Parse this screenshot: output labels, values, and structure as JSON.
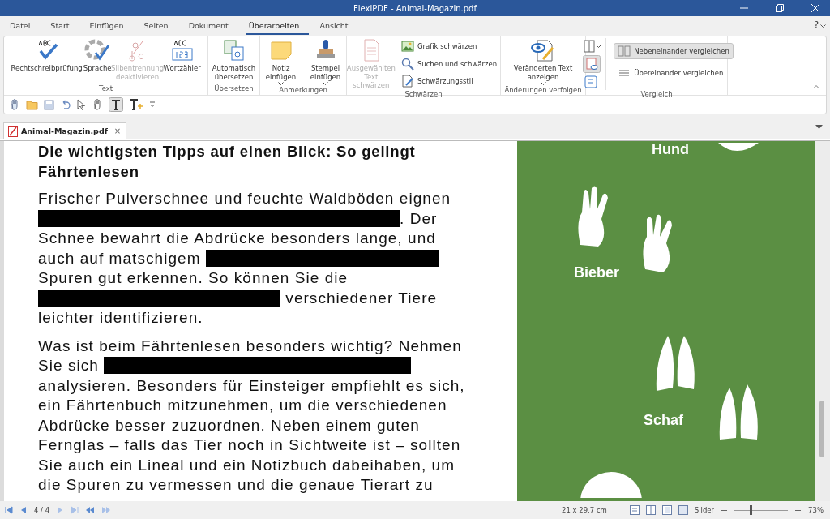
{
  "window": {
    "title": "FlexiPDF - Animal-Magazin.pdf"
  },
  "menu_tabs": [
    {
      "label": "Datei",
      "selected": false
    },
    {
      "label": "Start",
      "selected": false
    },
    {
      "label": "Einfügen",
      "selected": false
    },
    {
      "label": "Seiten",
      "selected": false
    },
    {
      "label": "Dokument",
      "selected": false
    },
    {
      "label": "Überarbeiten",
      "selected": true
    },
    {
      "label": "Ansicht",
      "selected": false
    }
  ],
  "help": "?",
  "ribbon_groups": [
    {
      "label": "Text",
      "buttons": [
        {
          "kind": "large",
          "label": "Rechtschreibprüfung",
          "disabled": false,
          "dropdown": false
        },
        {
          "kind": "large",
          "label": "Sprache",
          "disabled": false,
          "dropdown": false
        },
        {
          "kind": "large",
          "label": "Silbentrennung deaktivieren",
          "disabled": true,
          "dropdown": false
        },
        {
          "kind": "large",
          "label": "Wortzähler",
          "disabled": false,
          "dropdown": false
        }
      ]
    },
    {
      "label": "Übersetzen",
      "buttons": [
        {
          "kind": "large",
          "label": "Automatisch übersetzen",
          "disabled": false,
          "dropdown": false
        }
      ]
    },
    {
      "label": "Anmerkungen",
      "buttons": [
        {
          "kind": "large",
          "label": "Notiz einfügen",
          "disabled": false,
          "dropdown": true
        },
        {
          "kind": "large",
          "label": "Stempel einfügen",
          "disabled": false,
          "dropdown": true
        }
      ]
    },
    {
      "label": "Schwärzen",
      "buttons": [
        {
          "kind": "large",
          "label": "Ausgewählten Text schwärzen",
          "disabled": true,
          "dropdown": false
        },
        {
          "kind": "small",
          "label": "Grafik schwärzen",
          "disabled": false,
          "selected": false
        },
        {
          "kind": "small",
          "label": "Suchen und schwärzen",
          "disabled": false,
          "selected": false
        },
        {
          "kind": "small",
          "label": "Schwärzungsstil",
          "disabled": false,
          "selected": false
        }
      ]
    },
    {
      "label": "Änderungen verfolgen",
      "buttons": [
        {
          "kind": "large",
          "label": "Veränderten Text anzeigen",
          "disabled": false,
          "dropdown": true
        }
      ]
    },
    {
      "label": "Vergleich",
      "buttons": [
        {
          "kind": "iconcol"
        },
        {
          "kind": "small",
          "label": "Nebeneinander vergleichen",
          "disabled": false,
          "selected": true
        },
        {
          "kind": "small",
          "label": "Übereinander vergleichen",
          "disabled": false,
          "selected": false
        }
      ]
    }
  ],
  "document_tab": {
    "label": "Animal-Magazin.pdf",
    "close": "×"
  },
  "page": {
    "heading": "Die wichtigsten Tipps auf einen Blick: So gelingt Fährtenlesen",
    "paragraphs": [
      {
        "segments": [
          {
            "kind": "text",
            "text": "Frischer Pulverschnee und feuchte Waldböden eignen "
          },
          {
            "kind": "redaction"
          },
          {
            "kind": "text",
            "text": ". Der Schnee bewahrt die Abdrücke besonders lange, und auch auf matschigem "
          },
          {
            "kind": "redaction"
          },
          {
            "kind": "text",
            "text": " Spuren gut erkennen. So können Sie die "
          },
          {
            "kind": "redaction"
          },
          {
            "kind": "text",
            "text": " verschiedener Tiere leichter identifizieren."
          }
        ]
      },
      {
        "segments": [
          {
            "kind": "text",
            "text": "Was ist beim Fährtenlesen besonders wichtig? Nehmen Sie sich "
          },
          {
            "kind": "redaction"
          },
          {
            "kind": "text",
            "text": " analysieren. Besonders für Einsteiger empfiehlt es sich, ein Fährtenbuch mitzunehmen, um die verschiedenen Abdrücke besser zuzuordnen. Neben einem guten Fernglas – falls das Tier noch in Sichtweite ist – sollten Sie auch ein Lineal und ein Notizbuch dabeihaben, um die Spuren zu vermessen und die genaue Tierart zu"
          }
        ]
      }
    ],
    "animal_labels": [
      "Hund",
      "Bieber",
      "Schaf"
    ]
  },
  "status_bar": {
    "page": "4 / 4",
    "page_size": "21 x 29.7 cm",
    "zoom_mode": "Slider",
    "zoom": {
      "level": 0.3
    },
    "zoom_value": "73%"
  }
}
